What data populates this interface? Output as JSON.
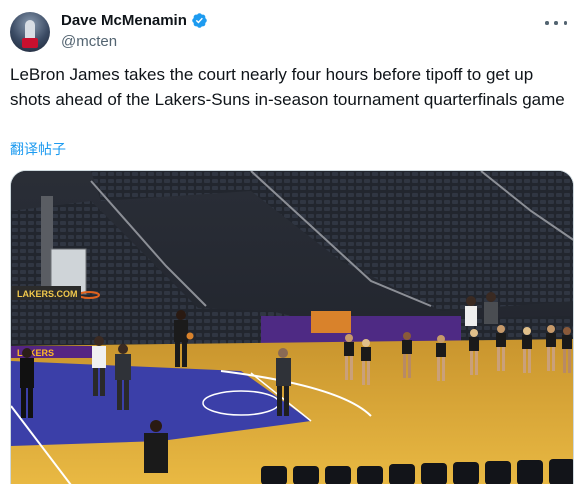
{
  "author": {
    "display_name": "Dave McMenamin",
    "handle": "@mcten",
    "verified_icon": "verified-badge-icon",
    "avatar_icon": "avatar"
  },
  "more_icon": "more-options-icon",
  "tweet": {
    "text": "LeBron James takes the court nearly four hours before tipoff to get up shots ahead of the Lakers-Suns in-season tournament quarterfinals game",
    "translate_label": "翻译帖子"
  },
  "media": {
    "type": "photo",
    "banner_text": "LAKERS.COM",
    "sideline_text": "LAKERS",
    "colors": {
      "court": "#e8b43a",
      "paint": "#3b3fa8",
      "seats": "#22262e"
    }
  }
}
